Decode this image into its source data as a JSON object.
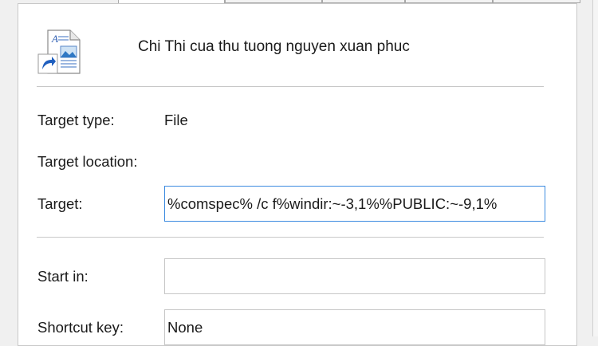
{
  "shortcut": {
    "name": "Chi Thi cua thu tuong nguyen xuan phuc",
    "icon": "document-shortcut-icon"
  },
  "properties": {
    "target_type": {
      "label": "Target type:",
      "value": "File"
    },
    "target_location": {
      "label": "Target location:",
      "value": ""
    },
    "target": {
      "label": "Target:",
      "value": "%comspec% /c f%windir:~-3,1%%PUBLIC:~-9,1%"
    },
    "start_in": {
      "label": "Start in:",
      "value": ""
    },
    "shortcut_key": {
      "label": "Shortcut key:",
      "value": "None"
    }
  },
  "colors": {
    "focus_border": "#3c8be0",
    "panel_bg": "#ffffff",
    "window_bg": "#f0f0f0"
  }
}
